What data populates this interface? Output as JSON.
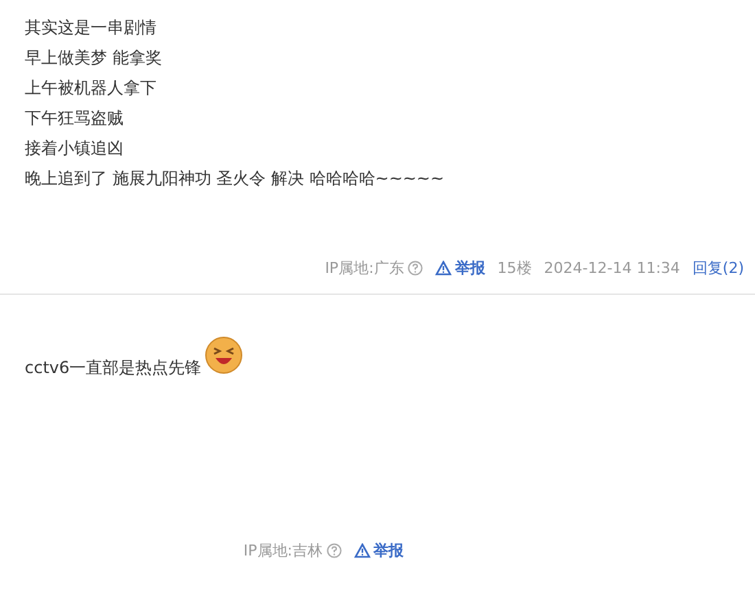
{
  "comments": [
    {
      "lines": [
        "其实这是一串剧情",
        "早上做美梦 能拿奖",
        "上午被机器人拿下",
        "下午狂骂盗贼",
        "接着小镇追凶",
        "晚上追到了 施展九阳神功 圣火令 解决 哈哈哈哈~~~~~"
      ],
      "footer": {
        "ip": "IP属地:广东",
        "report": "举报",
        "floor": "15楼",
        "time": "2024-12-14 11:34",
        "reply": "回复(2)"
      }
    },
    {
      "lines": [
        "cctv6一直部是热点先锋"
      ],
      "emoji": true,
      "footer": {
        "ip": "IP属地:吉林",
        "report": "举报"
      }
    }
  ]
}
